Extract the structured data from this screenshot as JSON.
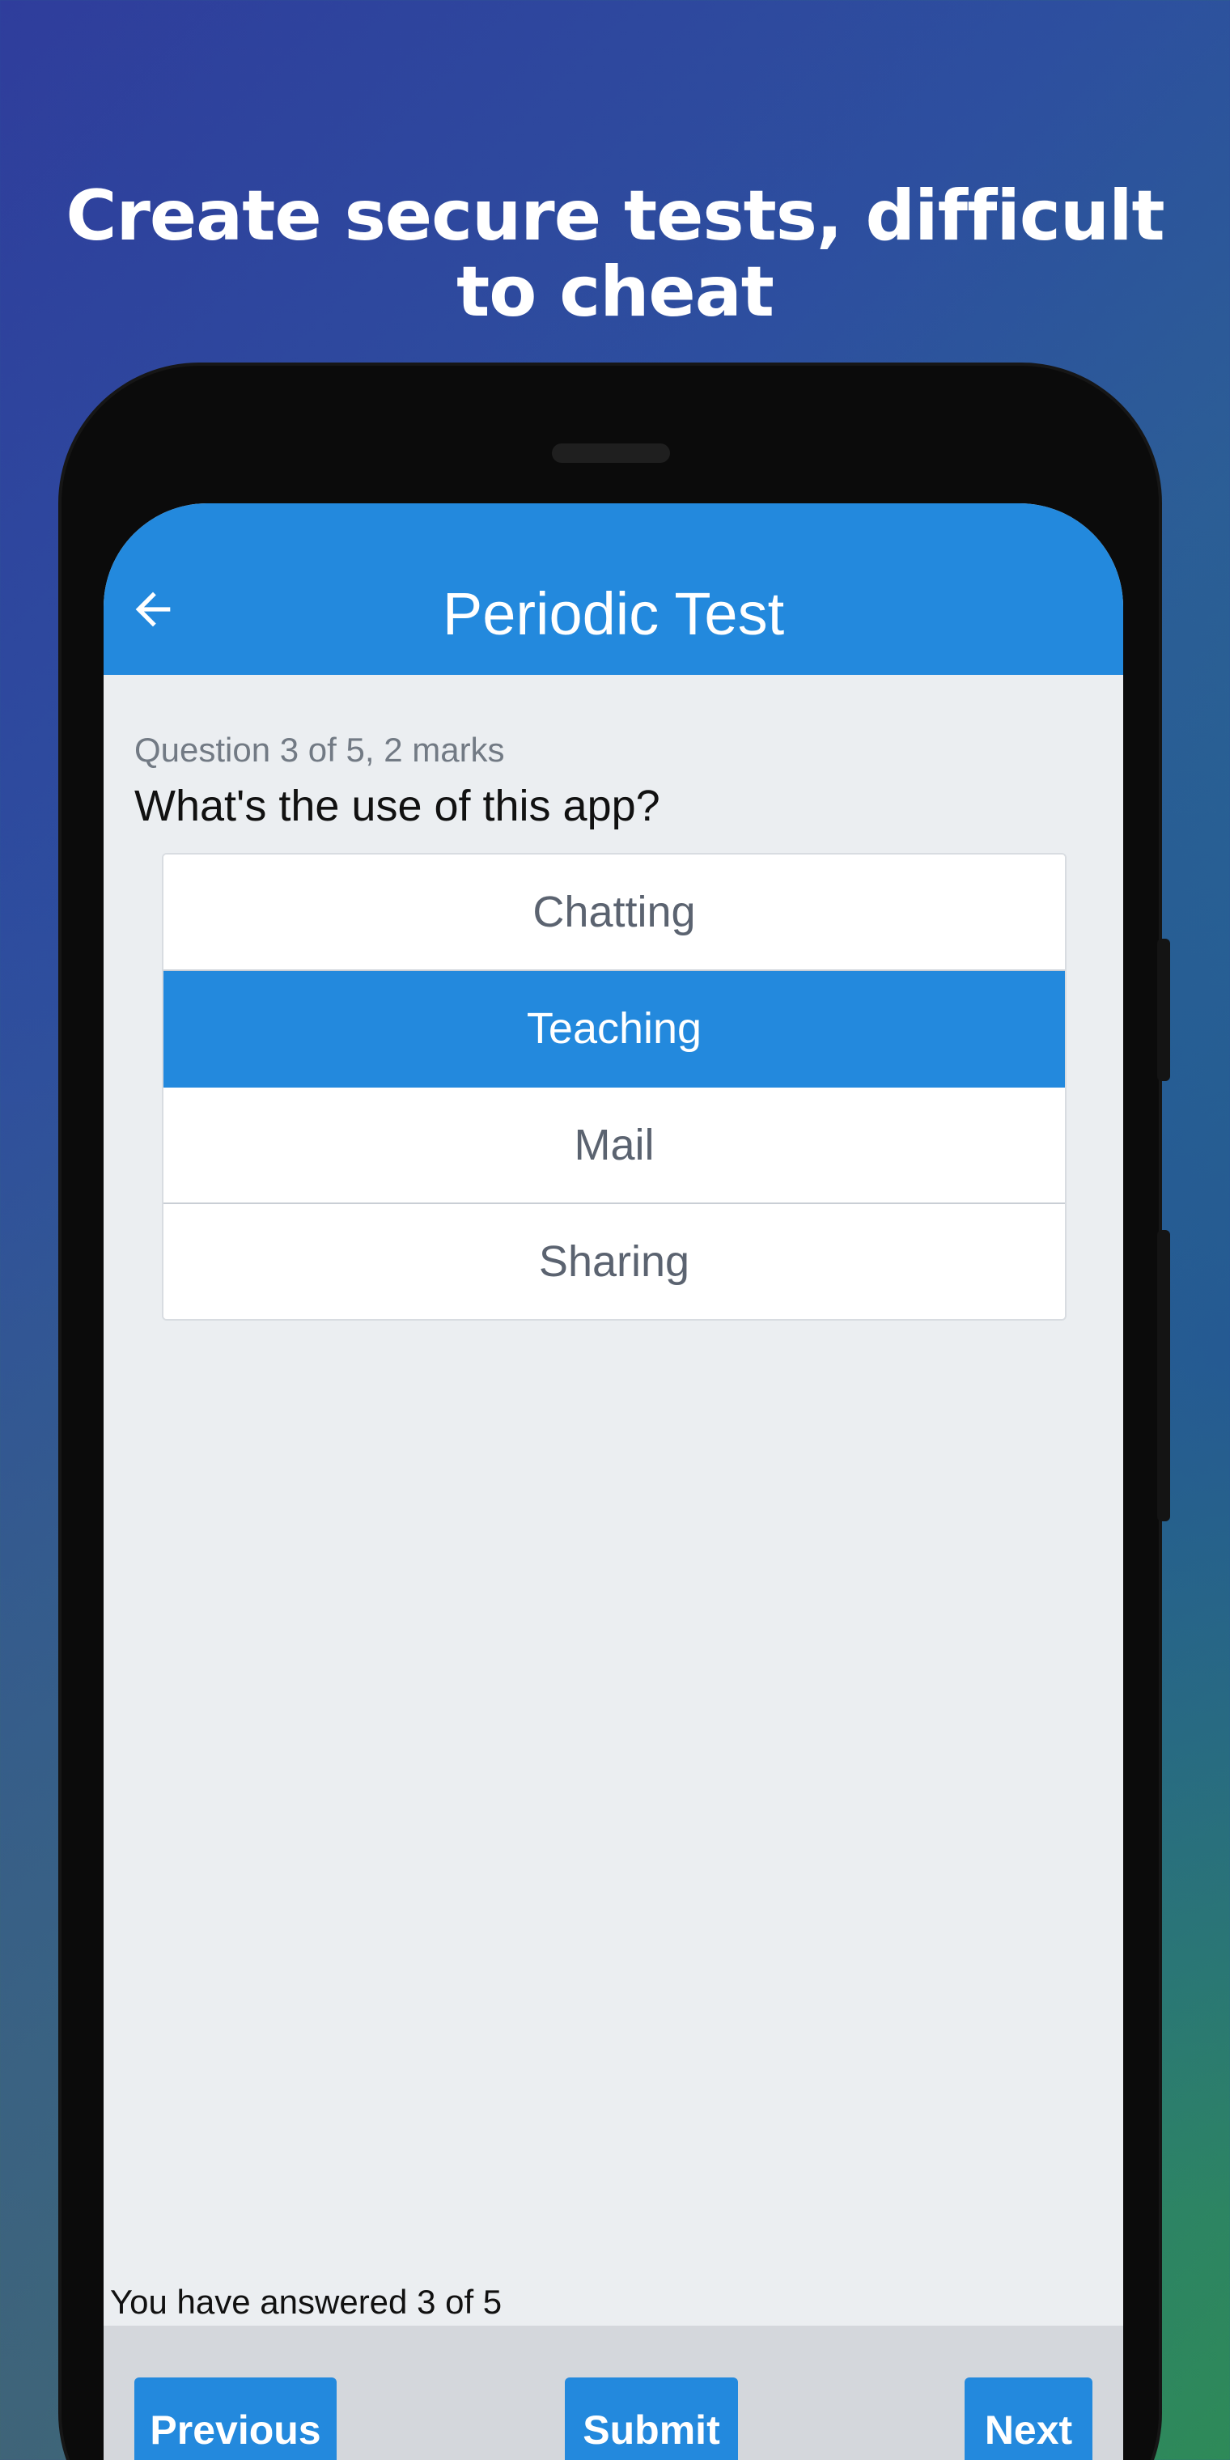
{
  "headline": "Create secure tests, difficult to cheat",
  "appbar": {
    "title": "Periodic Test"
  },
  "question": {
    "meta": "Question 3 of 5, 2 marks",
    "text": "What's the use of this app?",
    "options": [
      {
        "label": "Chatting",
        "selected": false
      },
      {
        "label": "Teaching",
        "selected": true
      },
      {
        "label": "Mail",
        "selected": false
      },
      {
        "label": "Sharing",
        "selected": false
      }
    ]
  },
  "progress": {
    "text": "You have answered 3 of 5"
  },
  "buttons": {
    "previous": "Previous",
    "submit": "Submit",
    "next": "Next"
  },
  "colors": {
    "accent": "#2389dd",
    "screen_bg": "#ebeef1",
    "bottom_bar": "#d4d7dc"
  },
  "icons": {
    "back": "arrow-left-icon"
  }
}
